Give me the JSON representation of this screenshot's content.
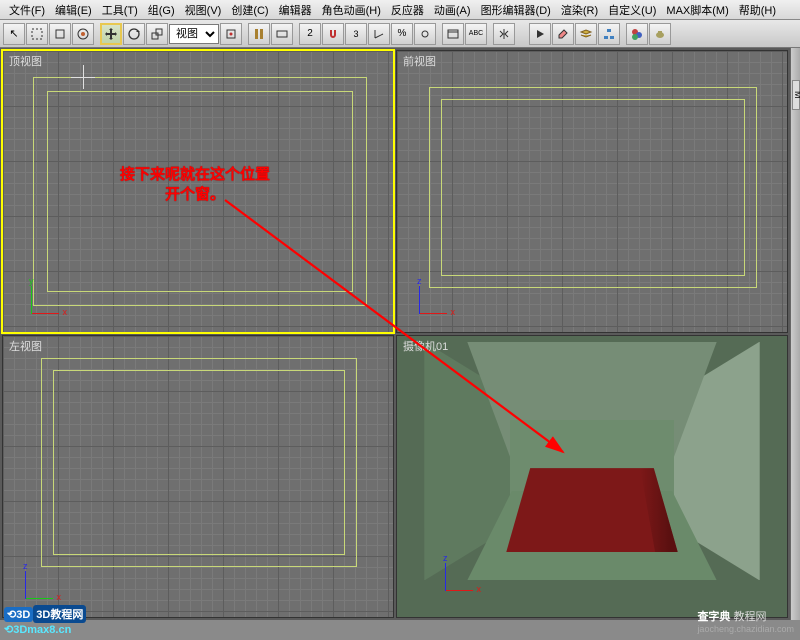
{
  "menu": {
    "items": [
      {
        "label": "文件(F)"
      },
      {
        "label": "编辑(E)"
      },
      {
        "label": "工具(T)"
      },
      {
        "label": "组(G)"
      },
      {
        "label": "视图(V)"
      },
      {
        "label": "创建(C)"
      },
      {
        "label": "编辑器"
      },
      {
        "label": "角色动画(H)"
      },
      {
        "label": "反应器"
      },
      {
        "label": "动画(A)"
      },
      {
        "label": "图形编辑器(D)"
      },
      {
        "label": "渲染(R)"
      },
      {
        "label": "自定义(U)"
      },
      {
        "label": "MAX脚本(M)"
      },
      {
        "label": "帮助(H)"
      }
    ]
  },
  "toolbar": {
    "dropdown_value": "视图"
  },
  "viewports": {
    "top": {
      "label": "顶视图"
    },
    "front": {
      "label": "前视图"
    },
    "left": {
      "label": "左视图"
    },
    "camera": {
      "label": "摄像机01"
    }
  },
  "annotation": {
    "line1": "接下来呢就在这个位置",
    "line2": "开个窗。"
  },
  "watermark": {
    "left_badge": "3D教程网",
    "left_url": "3Dmax8.cn",
    "right_main": "查字典",
    "right_sub": "教程网",
    "right_url": "jaocheng.chazidian.com"
  },
  "side": {
    "tab": "M"
  }
}
